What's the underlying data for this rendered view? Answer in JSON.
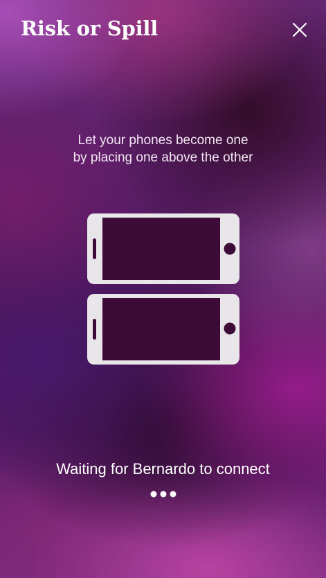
{
  "header": {
    "app_title": "Risk or Spill"
  },
  "icons": {
    "close": "close-icon",
    "phones": "phones-stacked-icon",
    "loading": "loading-dots-icon"
  },
  "instruction": {
    "line1": "Let your phones become one",
    "line2": "by placing one above the other"
  },
  "status": {
    "waiting_text": "Waiting for Bernardo to connect"
  },
  "colors": {
    "phone_body": "#e9e6ea",
    "phone_screen": "#3d0b38",
    "text": "#ffffff"
  }
}
